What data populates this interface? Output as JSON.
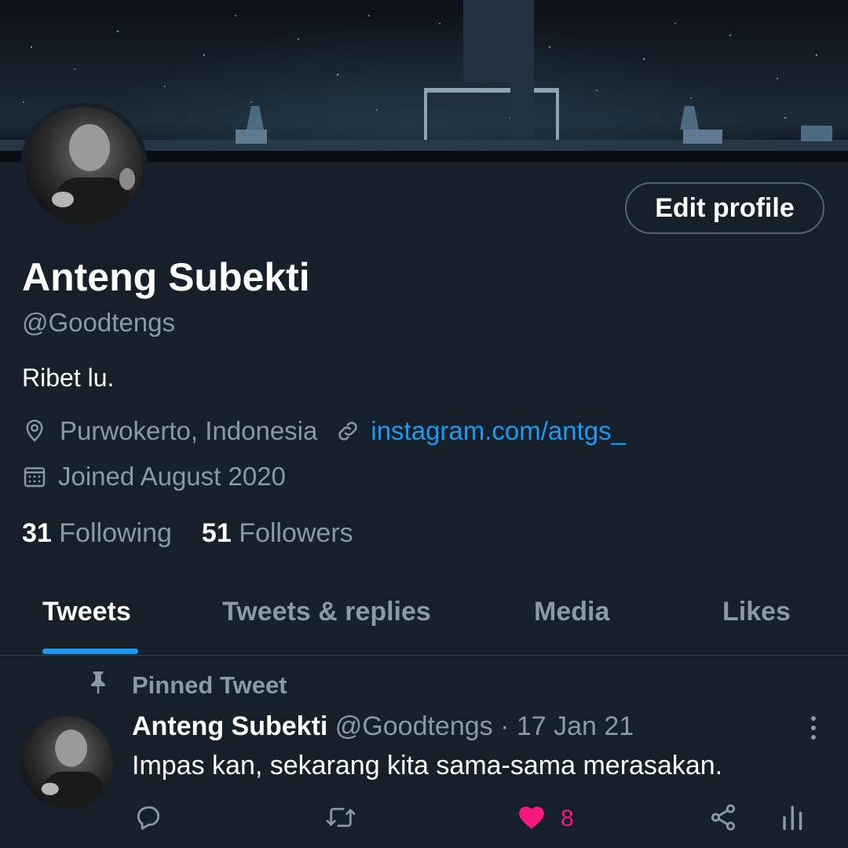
{
  "profile": {
    "name": "Anteng Subekti",
    "handle": "@Goodtengs",
    "bio": "Ribet lu.",
    "location": "Purwokerto, Indonesia",
    "website": "instagram.com/antgs_",
    "joined": "Joined August 2020",
    "following_count": "31",
    "following_label": "Following",
    "followers_count": "51",
    "followers_label": "Followers",
    "edit_label": "Edit profile"
  },
  "tabs": [
    {
      "label": "Tweets",
      "active": true
    },
    {
      "label": "Tweets & replies",
      "active": false
    },
    {
      "label": "Media",
      "active": false
    },
    {
      "label": "Likes",
      "active": false
    }
  ],
  "tweet": {
    "pinned_label": "Pinned Tweet",
    "author": "Anteng Subekti",
    "handle_date": "@Goodtengs · 17 Jan 21",
    "text": "Impas kan, sekarang kita sama-sama merasakan.",
    "like_count": "8",
    "liked": true
  },
  "colors": {
    "background": "#15202b",
    "accent": "#1d9bf0",
    "like": "#f91880",
    "muted": "#8b98a5"
  },
  "icons": [
    "location-icon",
    "link-icon",
    "calendar-icon",
    "pin-icon",
    "more-icon",
    "reply-icon",
    "retweet-icon",
    "heart-icon",
    "share-icon",
    "analytics-icon"
  ]
}
